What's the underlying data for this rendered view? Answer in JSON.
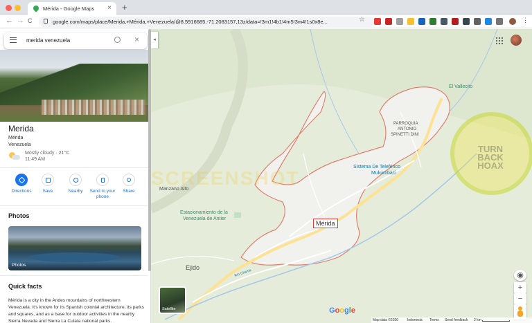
{
  "browser": {
    "tab_title": "Mérida - Google Maps",
    "tab_close": "×",
    "new_tab": "+",
    "url": "google.com/maps/place/Merida,+Mérida,+Venezuela/@8.5916685,-71.2083157,13z/data=!3m1!4b1!4m5!3m4!1s0x8e...",
    "back": "←",
    "forward": "→",
    "reload": "C"
  },
  "search": {
    "query": "merida venezuela",
    "close": "×"
  },
  "collapse_arrow": "◂",
  "place": {
    "title": "Merida",
    "region": "Mérida",
    "country": "Venezuela",
    "weather": "Mostly cloudy · 21°C",
    "time": "11:49 AM"
  },
  "actions": [
    {
      "label": "Directions"
    },
    {
      "label": "Save"
    },
    {
      "label": "Nearby"
    },
    {
      "label": "Send to your phone"
    },
    {
      "label": "Share"
    }
  ],
  "photos": {
    "heading": "Photos",
    "caption": "Photos"
  },
  "quick_facts": {
    "heading": "Quick facts",
    "text": "Mérida is a city in the Andes mountains of northwestern Venezuela. It's known for its Spanish colonial architecture, its parks and squares, and as a base for outdoor activities in the nearby Sierra Nevada and Sierra La Culata national parks."
  },
  "map": {
    "labels": {
      "vallecito": "El Vallecito",
      "parroquia": "PARROQUIA",
      "antonio": "ANTONIO",
      "spinetti": "SPINETTI DINI",
      "teleferico": "Sistema De Teleférico",
      "mukumbari": "Mukumbarí",
      "manzano": "Manzano Alto",
      "estacionamiento": "Estacionamiento de la",
      "venezuela_antier": "Venezuela de Antier",
      "ejido": "Ejido",
      "city": "Mérida",
      "rio": "Río Chama"
    },
    "satellite": "Satellite",
    "google": "Google",
    "footer": {
      "data": "Map data ©2020",
      "country": "Indonesia",
      "terms": "Terms",
      "feedback": "Send feedback",
      "scale": "2 km"
    },
    "zoom_in": "+",
    "zoom_out": "−",
    "locate": "◉",
    "watermark_top": "TURN",
    "watermark_mid": "BACK",
    "watermark_bot": "HOAX",
    "watermark_band": "SCREENSHOT"
  }
}
